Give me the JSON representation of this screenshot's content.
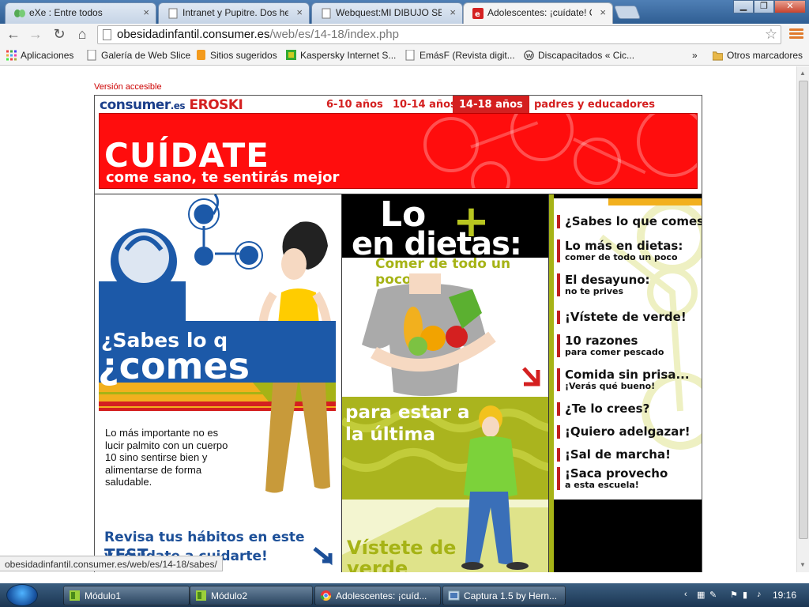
{
  "tabs": [
    {
      "title": "eXe : Entre todos"
    },
    {
      "title": "Intranet y Pupitre. Dos her"
    },
    {
      "title": "Webquest:MI DIBUJO SE M"
    },
    {
      "title": "Adolescentes: ¡cuídate! Co"
    }
  ],
  "window_controls": {
    "minimize": "▁",
    "maximize": "❐",
    "close": "✕"
  },
  "address": {
    "host": "obesidadinfantil.consumer.es",
    "path": "/web/es/14-18/index.php"
  },
  "bookmarks": [
    {
      "label": "Aplicaciones"
    },
    {
      "label": "Galería de Web Slice"
    },
    {
      "label": "Sitios sugeridos"
    },
    {
      "label": "Kaspersky Internet S..."
    },
    {
      "label": "EmásF (Revista digit..."
    },
    {
      "label": "Discapacitados « Cic..."
    }
  ],
  "bookmarks_more": "»",
  "other_bookmarks": "Otros marcadores",
  "page": {
    "accesible": "Versión accesible",
    "logo": {
      "consumer": "consumer",
      "es": ".es",
      "eroski": "EROSKI"
    },
    "age_tabs": [
      "6-10 años",
      "10-14 años",
      "14-18 años",
      "padres y educadores"
    ],
    "banner": {
      "title": "CUÍDATE",
      "subtitle": "come sano, te sentirás mejor"
    },
    "col1": {
      "sabes": "¿Sabes lo q",
      "comes": "¿comes",
      "text": "Lo más importante no es lucir palmito con un cuerpo 10 sino sentirse bien y alimentarse de forma saludable.",
      "revisa": "Revisa tus hábitos en este",
      "test": "TEST",
      "revisa2": "y ¡cuídate a cuidarte!"
    },
    "col2": {
      "lo": "Lo",
      "plus": "+",
      "en_dietas": "en dietas:",
      "comer": "Comer de todo un poco",
      "para": "para estar a la última",
      "vistete": "Vístete de verde"
    },
    "menu": [
      {
        "title": "¿Sabes lo que comes?",
        "sub": ""
      },
      {
        "title": "Lo más en dietas:",
        "sub": "comer de todo un poco"
      },
      {
        "title": "El desayuno:",
        "sub": "no te prives"
      },
      {
        "title": "¡Vístete de verde!",
        "sub": ""
      },
      {
        "title": "10 razones",
        "sub": "para comer pescado"
      },
      {
        "title": "Comida sin prisa...",
        "sub": "¡Verás qué bueno!"
      },
      {
        "title": "¿Te lo crees?",
        "sub": ""
      },
      {
        "title": "¡Quiero adelgazar!",
        "sub": ""
      },
      {
        "title": "¡Sal de marcha!",
        "sub": ""
      },
      {
        "title": "¡Saca provecho",
        "sub": "a esta escuela!"
      }
    ]
  },
  "status_url": "obesidadinfantil.consumer.es/web/es/14-18/sabes/",
  "taskbar": [
    {
      "label": "Módulo1"
    },
    {
      "label": "Módulo2"
    },
    {
      "label": "Adolescentes: ¡cuíd..."
    },
    {
      "label": "Captura 1.5 by Hern..."
    }
  ],
  "clock": "19:16",
  "colors": {
    "brand_red": "#ff0d0d",
    "brand_blue": "#1c59a8",
    "lime": "#aab41e",
    "gold": "#f2b01e"
  }
}
